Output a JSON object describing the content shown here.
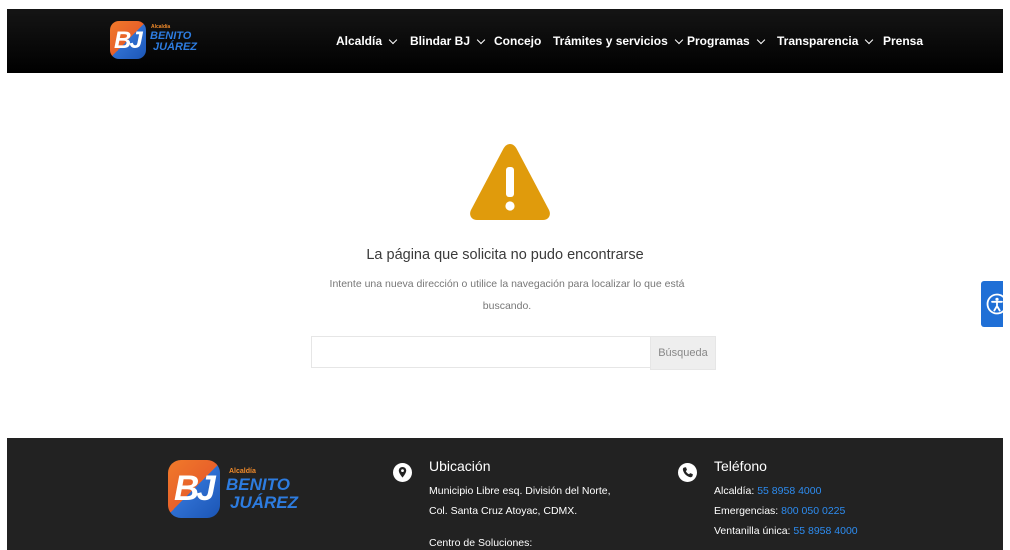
{
  "header": {
    "logo": {
      "small_text": "Alcaldía",
      "line1": "BENITO",
      "line2": "JUÁREZ",
      "monogram": "BJ"
    },
    "nav": [
      {
        "label": "Alcaldía",
        "has_dropdown": true
      },
      {
        "label": "Blindar BJ",
        "has_dropdown": true
      },
      {
        "label": "Concejo",
        "has_dropdown": false
      },
      {
        "label": "Trámites y servicios",
        "has_dropdown": true
      },
      {
        "label": "Programas",
        "has_dropdown": true
      },
      {
        "label": "Transparencia",
        "has_dropdown": true
      },
      {
        "label": "Prensa",
        "has_dropdown": false
      }
    ]
  },
  "main": {
    "icon": "warning-icon",
    "title": "La página que solicita no pudo encontrarse",
    "subtitle_line1": "Intente una nueva dirección o utilice la navegación para localizar lo que está",
    "subtitle_line2": "buscando.",
    "search": {
      "value": "",
      "placeholder": "",
      "button_label": "Búsqueda"
    }
  },
  "accessibility_button": {
    "icon": "accessibility-icon"
  },
  "footer": {
    "logo": {
      "small_text": "Alcaldía",
      "line1": "BENITO",
      "line2": "JUÁREZ",
      "monogram": "BJ"
    },
    "location": {
      "icon": "location-pin-icon",
      "heading": "Ubicación",
      "lines": [
        "Municipio Libre esq. División del Norte,",
        "Col. Santa Cruz Atoyac, CDMX.",
        "",
        "Centro de Soluciones:"
      ]
    },
    "phone": {
      "icon": "phone-icon",
      "heading": "Teléfono",
      "entries": [
        {
          "label": "Alcaldía: ",
          "number": "55 8958 4000"
        },
        {
          "label": "Emergencias: ",
          "number": "800 050 0225"
        },
        {
          "label": "Ventanilla única: ",
          "number": "55 8958 4000"
        }
      ]
    }
  },
  "colors": {
    "accent_link": "#2d8cf0",
    "warning": "#e09b0c",
    "header_bg": "#000000",
    "footer_bg": "#222222",
    "a11y_bg": "#1f6fd6"
  }
}
